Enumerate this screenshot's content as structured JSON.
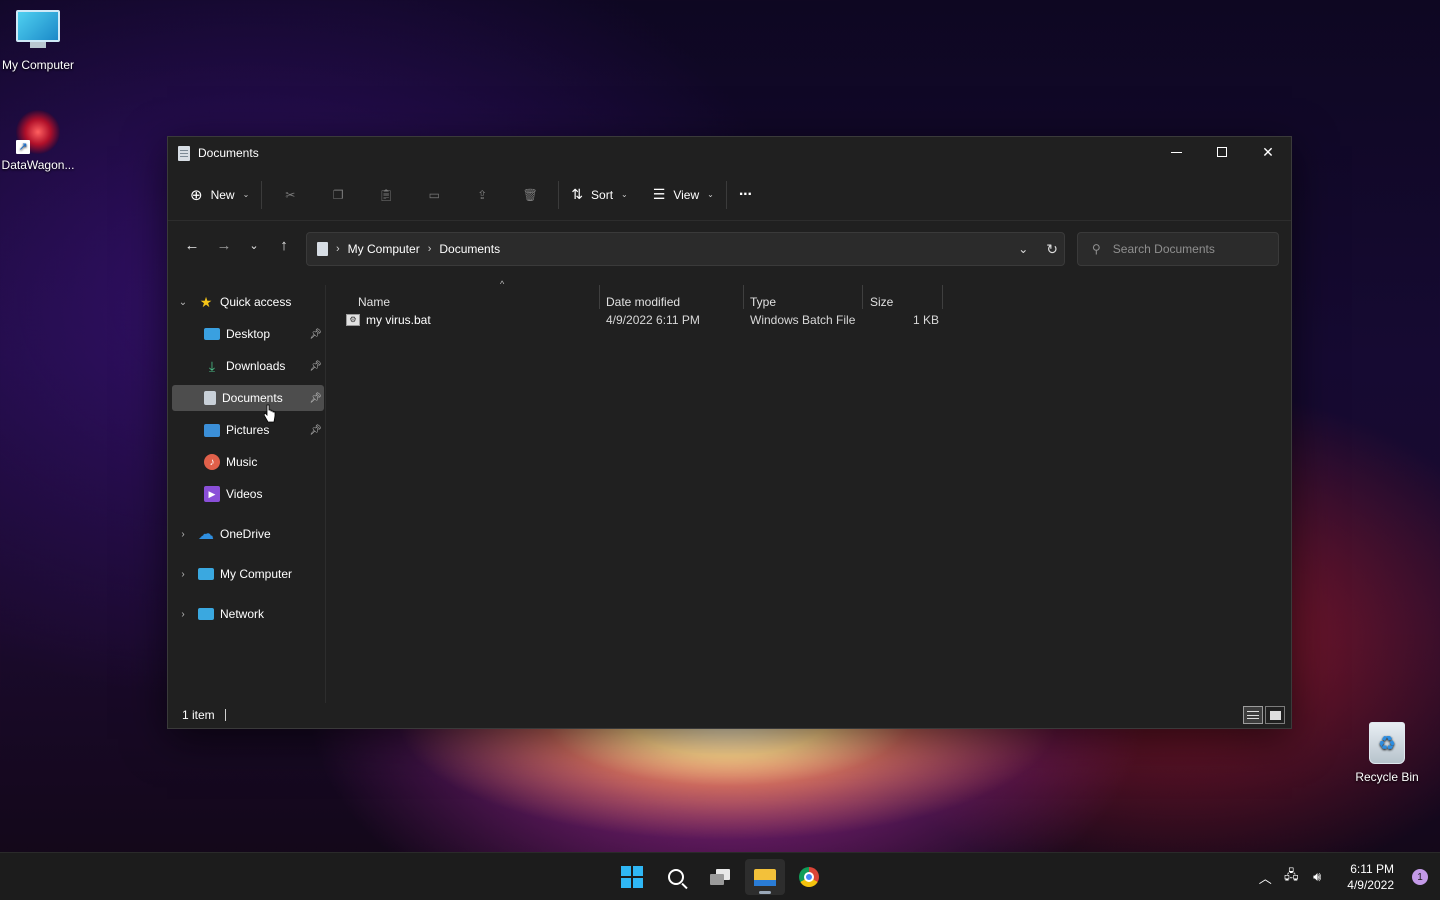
{
  "desktop": {
    "icons": [
      {
        "label": "My Computer",
        "icon": "computer-icon"
      },
      {
        "label": "DataWagon...",
        "icon": "datawagon-shortcut-icon"
      },
      {
        "label": "Recycle Bin",
        "icon": "recycle-bin-icon"
      }
    ]
  },
  "window": {
    "title": "Documents",
    "toolbar": {
      "new_label": "New",
      "sort_label": "Sort",
      "view_label": "View",
      "more_label": "···"
    },
    "address": {
      "crumbs": [
        "My Computer",
        "Documents"
      ]
    },
    "search": {
      "placeholder": "Search Documents"
    },
    "sidebar": {
      "items": [
        {
          "label": "Quick access",
          "icon": "star-icon",
          "color": "#f5c518"
        },
        {
          "label": "Desktop",
          "icon": "desktop-icon",
          "color": "#3aa0e0",
          "pinned": true
        },
        {
          "label": "Downloads",
          "icon": "download-icon",
          "color": "#4cc38a",
          "pinned": true
        },
        {
          "label": "Documents",
          "icon": "document-icon",
          "color": "#c8d0d8",
          "pinned": true,
          "selected": true
        },
        {
          "label": "Pictures",
          "icon": "picture-icon",
          "color": "#3b8fd8",
          "pinned": true
        },
        {
          "label": "Music",
          "icon": "music-icon",
          "color": "#e0604a"
        },
        {
          "label": "Videos",
          "icon": "video-icon",
          "color": "#8a4fd8"
        },
        {
          "label": "OneDrive",
          "icon": "cloud-icon",
          "color": "#2f8fe0"
        },
        {
          "label": "My Computer",
          "icon": "computer-icon",
          "color": "#3aa8e0"
        },
        {
          "label": "Network",
          "icon": "network-icon",
          "color": "#3aa8e0"
        }
      ]
    },
    "columns": [
      "Name",
      "Date modified",
      "Type",
      "Size"
    ],
    "files": [
      {
        "name": "my virus.bat",
        "date_modified": "4/9/2022 6:11 PM",
        "type": "Windows Batch File",
        "size": "1 KB"
      }
    ],
    "status": {
      "item_count": "1 item"
    }
  },
  "taskbar": {
    "apps": [
      "start-button",
      "search-button",
      "task-view-button",
      "file-explorer-button",
      "chrome-button"
    ],
    "time": "6:11 PM",
    "date": "4/9/2022",
    "notification_count": "1"
  }
}
